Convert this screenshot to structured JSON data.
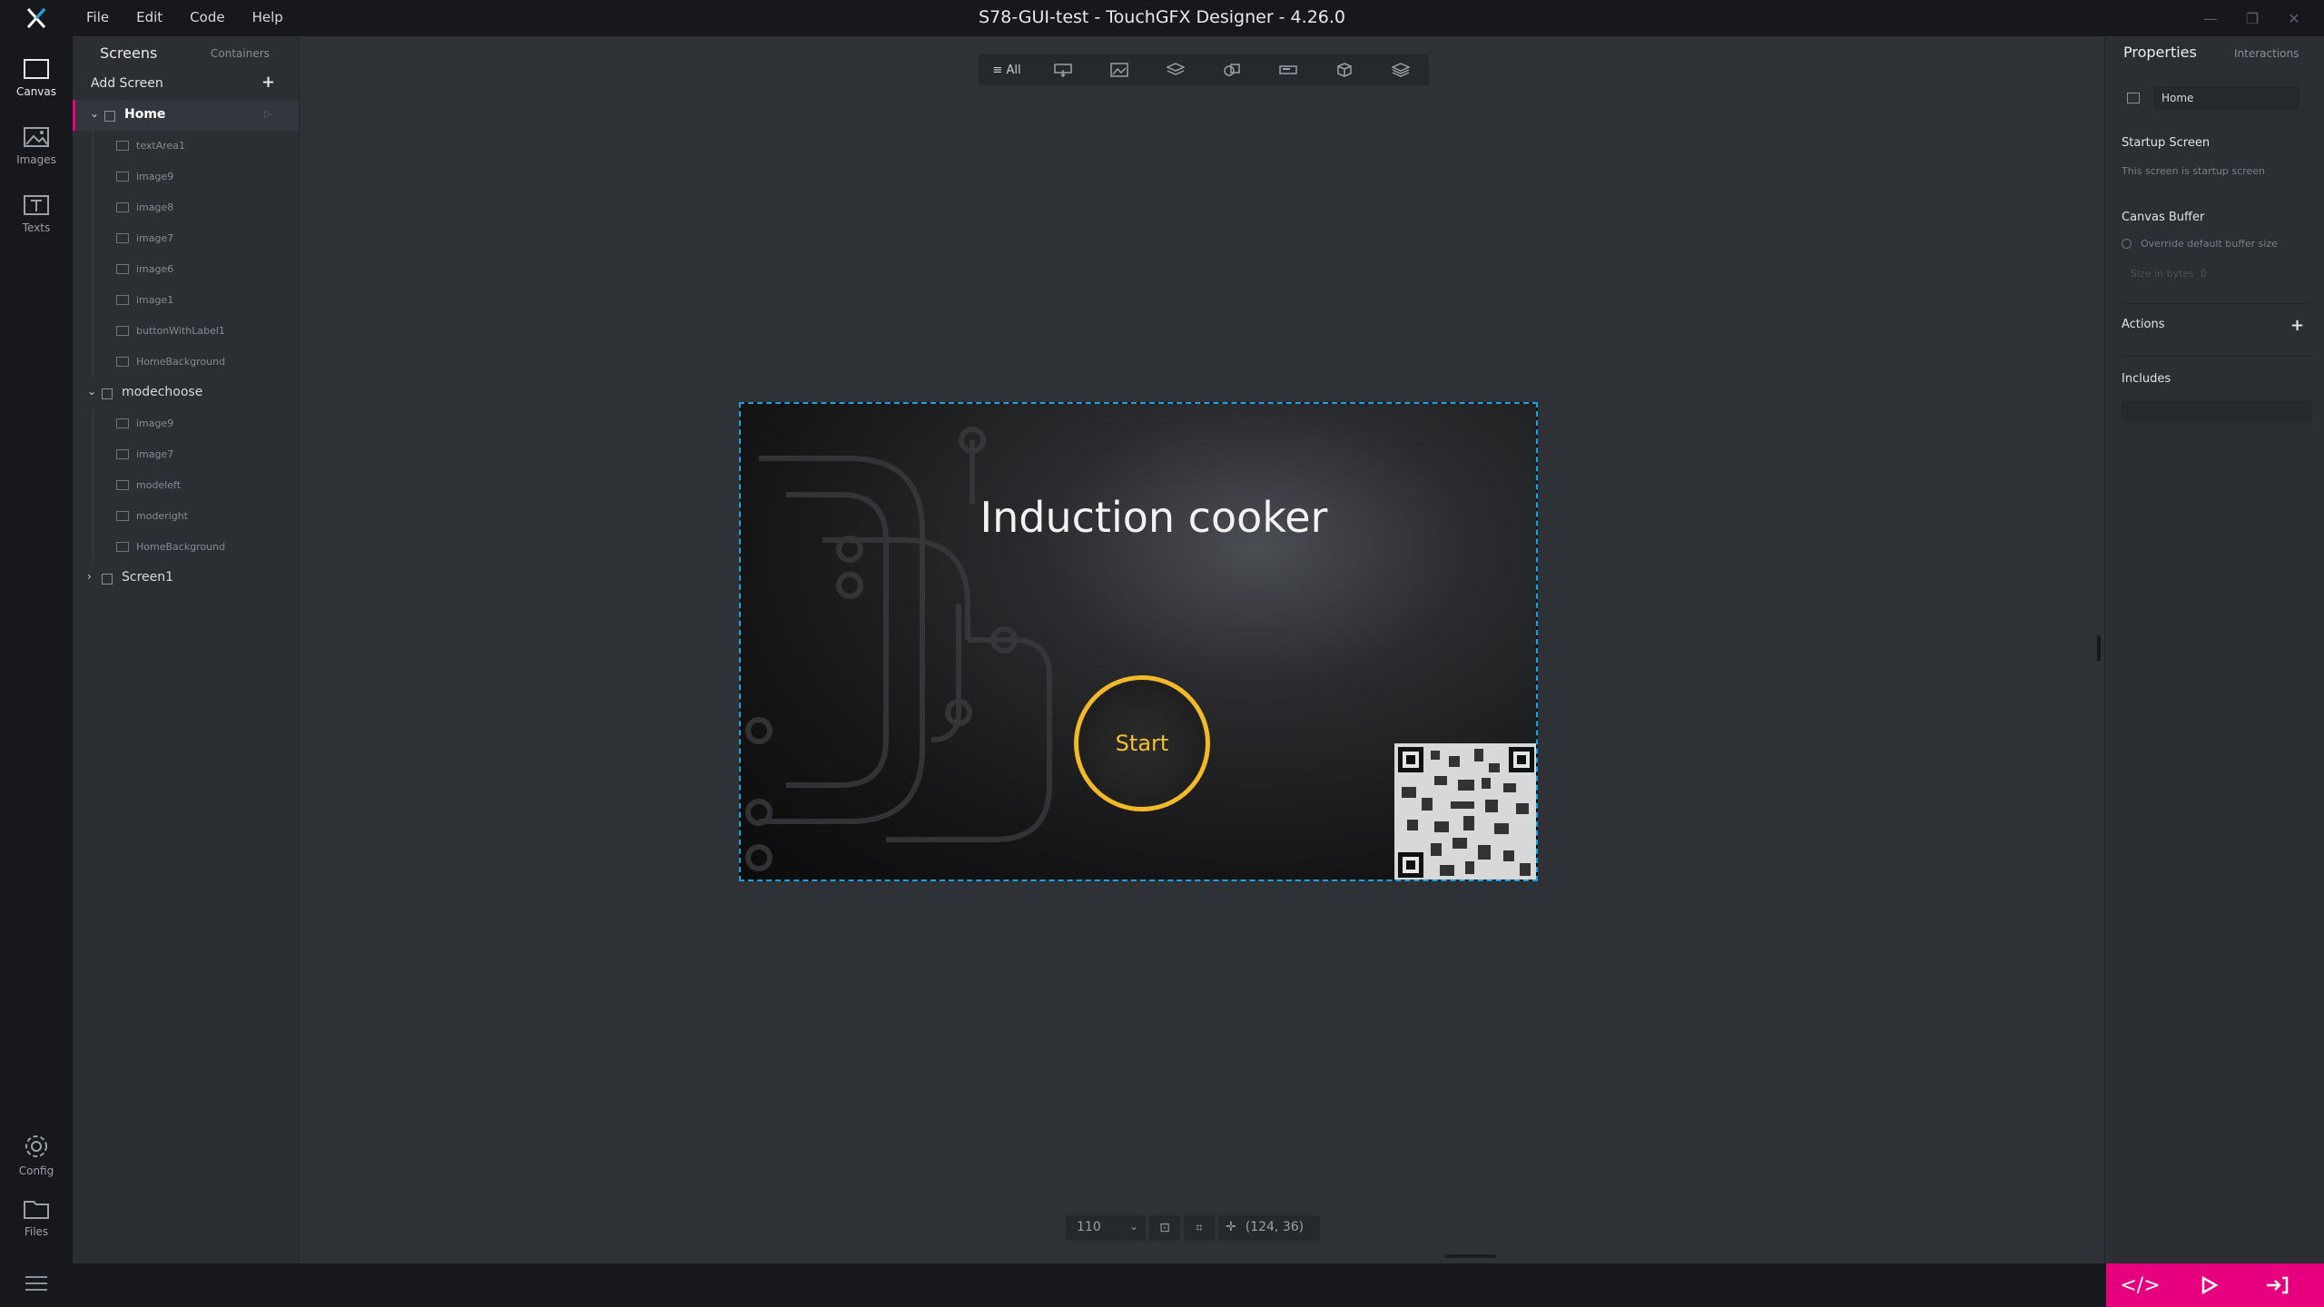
{
  "window": {
    "title": "S78-GUI-test - TouchGFX Designer - 4.26.0",
    "menu": [
      "File",
      "Edit",
      "Code",
      "Help"
    ]
  },
  "leftnav": [
    {
      "label": "Canvas",
      "icon": "canvas-icon"
    },
    {
      "label": "Images",
      "icon": "image-icon"
    },
    {
      "label": "Texts",
      "icon": "text-icon"
    },
    {
      "label": "Config",
      "icon": "gear-icon"
    },
    {
      "label": "Files",
      "icon": "folder-icon"
    }
  ],
  "screens_panel": {
    "tab_screens": "Screens",
    "tab_containers": "Containers",
    "add_screen": "Add Screen",
    "screens": [
      {
        "name": "Home",
        "expanded": true,
        "selected": true,
        "widgets": [
          "textArea1",
          "image9",
          "image8",
          "image7",
          "image6",
          "image1",
          "buttonWithLabel1",
          "HomeBackground"
        ]
      },
      {
        "name": "modechoose",
        "expanded": true,
        "selected": false,
        "widgets": [
          "image9",
          "image7",
          "modeleft",
          "moderight",
          "HomeBackground"
        ]
      },
      {
        "name": "Screen1",
        "expanded": false,
        "selected": false,
        "widgets": []
      }
    ]
  },
  "toolbar": {
    "all_label": "All"
  },
  "canvas": {
    "title_text": "Induction cooker",
    "button_text": "Start",
    "zoom": "110",
    "coords": "(124, 36)",
    "accent_color": "#f2b929",
    "selection_color": "#1aa3e0"
  },
  "properties": {
    "tab_properties": "Properties",
    "tab_interactions": "Interactions",
    "screen_name": "Home",
    "startup_title": "Startup Screen",
    "startup_desc": "This screen is startup screen",
    "canvas_buffer_title": "Canvas Buffer",
    "override_label": "Override default buffer size",
    "size_label": "Size in bytes",
    "size_value": "0",
    "actions_title": "Actions",
    "includes_title": "Includes"
  },
  "brand_color": "#e6007e"
}
